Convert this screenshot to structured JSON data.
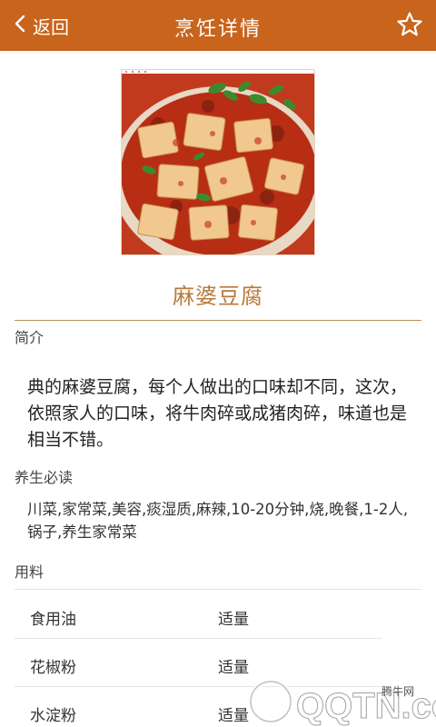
{
  "header": {
    "back_label": "返回",
    "title": "烹饪详情",
    "bg_color": "#c8641c"
  },
  "dish": {
    "name": "麻婆豆腐",
    "name_color": "#b8793b"
  },
  "intro": {
    "label": "简介",
    "text": "典的麻婆豆腐，每个人做出的口味却不同，这次，依照家人的口味，将牛肉碎或成猪肉碎，味道也是相当不错。"
  },
  "health": {
    "label": "养生必读",
    "text": "川菜,家常菜,美容,痰湿质,麻辣,10-20分钟,烧,晚餐,1-2人,锅子,养生家常菜"
  },
  "ingredients": {
    "label": "用料",
    "items": [
      {
        "name": "食用油",
        "amount": "适量"
      },
      {
        "name": "花椒粉",
        "amount": "适量"
      },
      {
        "name": "水淀粉",
        "amount": "适量"
      }
    ]
  },
  "watermark": {
    "site": "腾牛网",
    "brand": "QQTN.com"
  }
}
